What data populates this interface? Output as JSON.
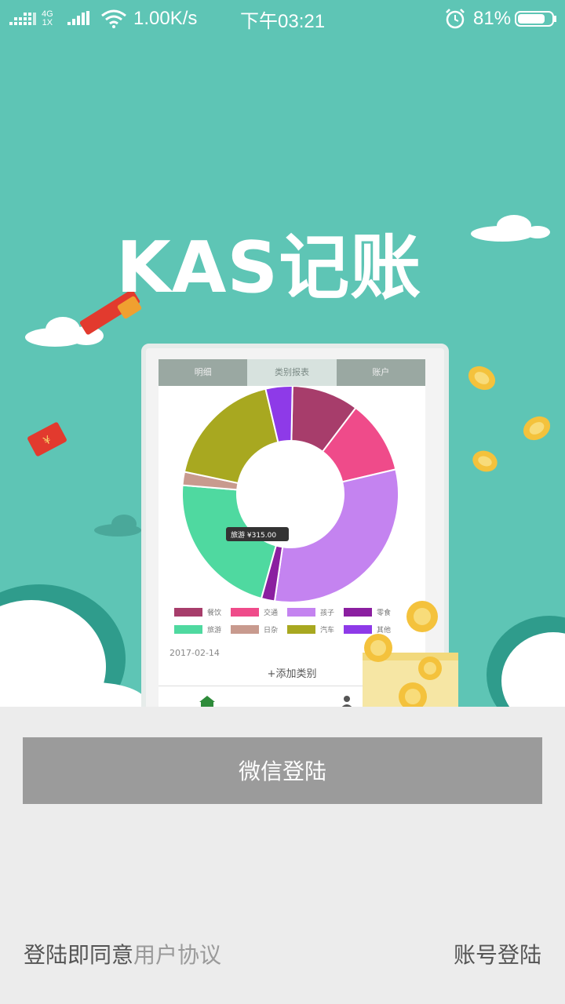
{
  "statusbar": {
    "network_type_top": "4G",
    "network_type_bottom": "1X",
    "speed": "1.00K/s",
    "time": "下午03:21",
    "battery": "81%",
    "battery_level": 0.81
  },
  "hero": {
    "title": "KAS记账",
    "phone": {
      "tabs": [
        "明细",
        "类别报表",
        "账户"
      ],
      "active_tab": 1,
      "tooltip": "旅游 ¥315.00",
      "date": "2017-02-14",
      "add_category": "+添加类别",
      "nav_items": [
        "首页",
        "我的"
      ],
      "legend": [
        {
          "label": "餐饮",
          "color": "#a73d6b"
        },
        {
          "label": "交通",
          "color": "#ef4b8a"
        },
        {
          "label": "孩子",
          "color": "#c483f0"
        },
        {
          "label": "零食",
          "color": "#8b1fa0"
        },
        {
          "label": "旅游",
          "color": "#4fd9a0"
        },
        {
          "label": "日杂",
          "color": "#c89a8e"
        },
        {
          "label": "汽车",
          "color": "#a8a820"
        },
        {
          "label": "其他",
          "color": "#8e3ae8"
        }
      ]
    },
    "chart_data": {
      "type": "pie",
      "series": [
        {
          "name": "餐饮",
          "value": 10,
          "color": "#a73d6b"
        },
        {
          "name": "交通",
          "value": 11,
          "color": "#ef4b8a"
        },
        {
          "name": "孩子",
          "value": 31,
          "color": "#c483f0"
        },
        {
          "name": "零食",
          "value": 2,
          "color": "#8b1fa0"
        },
        {
          "name": "旅游",
          "value": 22,
          "color": "#4fd9a0"
        },
        {
          "name": "日杂",
          "value": 2,
          "color": "#c89a8e"
        },
        {
          "name": "汽车",
          "value": 18,
          "color": "#a8a820"
        },
        {
          "name": "其他",
          "value": 4,
          "color": "#8e3ae8"
        }
      ]
    }
  },
  "login": {
    "wechat_button": "微信登陆",
    "agreement_prefix": "登陆即同意",
    "agreement_link": "用户协议",
    "account_login": "账号登陆"
  },
  "colors": {
    "hero_bg": "#5ec5b5",
    "button_bg": "#9b9b9b",
    "page_bg": "#ececec"
  }
}
